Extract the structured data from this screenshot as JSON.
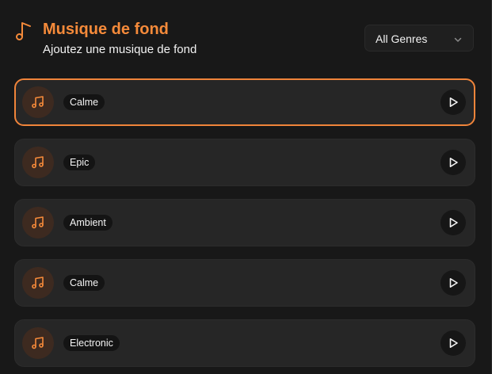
{
  "header": {
    "title": "Musique de fond",
    "subtitle": "Ajoutez une musique de fond",
    "icon": "music-note-icon"
  },
  "genre_filter": {
    "selected": "All Genres",
    "icon": "chevron-down-icon"
  },
  "colors": {
    "accent": "#f58a3a",
    "background": "#181818",
    "card": "#262626",
    "icon_circle": "#3d2a20"
  },
  "tracks": [
    {
      "label": "Calme",
      "selected": true,
      "icon": "music-notes-icon",
      "action_icon": "play-icon"
    },
    {
      "label": "Epic",
      "selected": false,
      "icon": "music-notes-icon",
      "action_icon": "play-icon"
    },
    {
      "label": "Ambient",
      "selected": false,
      "icon": "music-notes-icon",
      "action_icon": "play-icon"
    },
    {
      "label": "Calme",
      "selected": false,
      "icon": "music-notes-icon",
      "action_icon": "play-icon"
    },
    {
      "label": "Electronic",
      "selected": false,
      "icon": "music-notes-icon",
      "action_icon": "play-icon"
    }
  ]
}
